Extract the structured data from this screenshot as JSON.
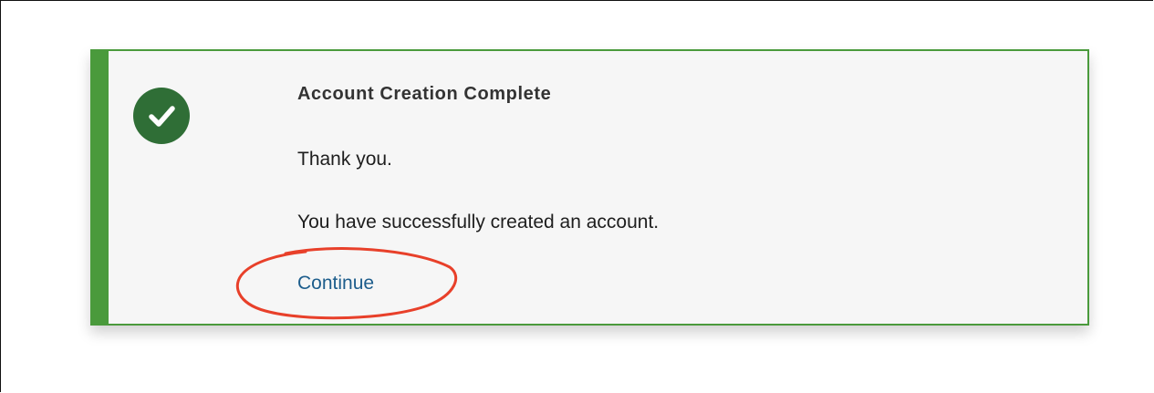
{
  "alert": {
    "icon": "check-circle-icon",
    "title": "Account Creation Complete",
    "message_line1": "Thank you.",
    "message_line2": "You have successfully created an account.",
    "link_label": "Continue"
  },
  "colors": {
    "success_border": "#4a9a3c",
    "icon_background": "#2f6e36",
    "link": "#1d5d8c",
    "annotation": "#e8402a"
  }
}
